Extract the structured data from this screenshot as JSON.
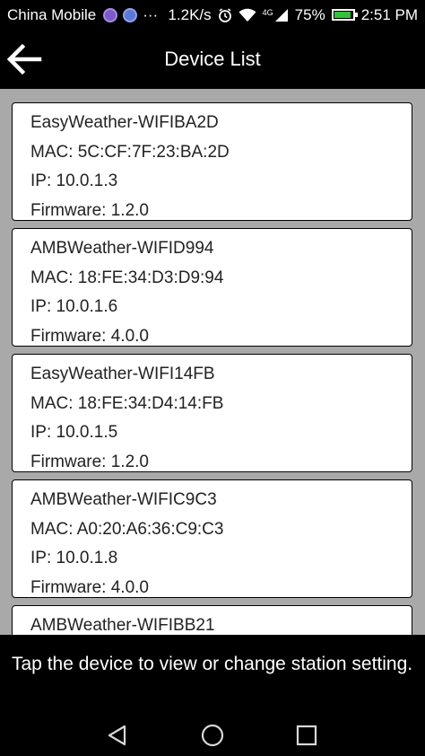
{
  "status_bar": {
    "carrier": "China Mobile",
    "more": "···",
    "speed": "1.2K/s",
    "network": "4G",
    "battery": "75%",
    "time": "2:51 PM"
  },
  "header": {
    "title": "Device List",
    "back_icon": "arrow-left-icon"
  },
  "devices": [
    {
      "name": "EasyWeather-WIFIBA2D",
      "mac": "MAC: 5C:CF:7F:23:BA:2D",
      "ip": "IP: 10.0.1.3",
      "firmware": "Firmware: 1.2.0"
    },
    {
      "name": "AMBWeather-WIFID994",
      "mac": "MAC: 18:FE:34:D3:D9:94",
      "ip": "IP: 10.0.1.6",
      "firmware": "Firmware: 4.0.0"
    },
    {
      "name": "EasyWeather-WIFI14FB",
      "mac": "MAC: 18:FE:34:D4:14:FB",
      "ip": "IP: 10.0.1.5",
      "firmware": "Firmware: 1.2.0"
    },
    {
      "name": "AMBWeather-WIFIC9C3",
      "mac": "MAC: A0:20:A6:36:C9:C3",
      "ip": "IP: 10.0.1.8",
      "firmware": "Firmware: 4.0.0"
    },
    {
      "name": "AMBWeather-WIFIBB21"
    }
  ],
  "footer": {
    "hint": "Tap the device to view or change station setting."
  },
  "nav": {
    "back_icon": "triangle-back-icon",
    "home_icon": "circle-home-icon",
    "recents_icon": "square-recents-icon"
  }
}
